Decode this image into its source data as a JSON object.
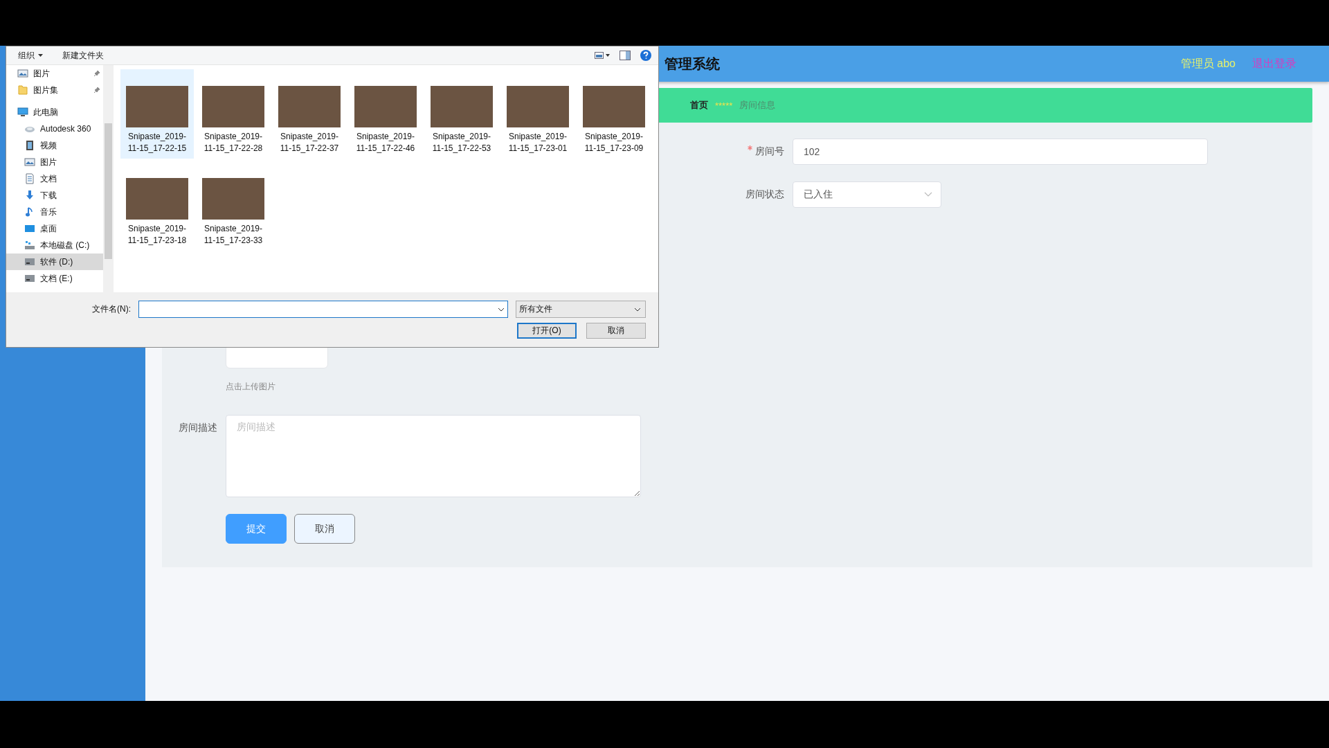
{
  "header": {
    "title": "管理系统",
    "user": "管理员 abo",
    "logout": "退出登录"
  },
  "breadcrumb": [
    {
      "kind": "home",
      "label": "首页"
    },
    {
      "kind": "separator",
      "label": "*****"
    },
    {
      "kind": "current",
      "label": "房间信息"
    }
  ],
  "form": {
    "fields": [
      {
        "kind": "input",
        "label": "房间号",
        "required": true,
        "value": "102"
      },
      {
        "kind": "select",
        "label": "房间状态",
        "required": false,
        "value": "已入住"
      }
    ],
    "upload": {
      "hint": "点击上传图片"
    },
    "description": {
      "label": "房间描述",
      "placeholder": "房间描述"
    },
    "buttons": [
      {
        "kind": "primary",
        "label": "提交"
      },
      {
        "kind": "plain",
        "label": "取消"
      }
    ]
  },
  "file_dialog": {
    "toolbar": [
      {
        "kind": "menu",
        "label": "组织"
      },
      {
        "kind": "plain",
        "label": "新建文件夹"
      }
    ],
    "nav": [
      {
        "label": "图片",
        "pinned": true,
        "selected": false
      },
      {
        "label": "图片集",
        "pinned": true,
        "selected": false
      },
      {
        "label": "此电脑",
        "pinned": false,
        "selected": false,
        "children": [
          {
            "label": "Autodesk 360",
            "pinned": false,
            "selected": false
          },
          {
            "label": "视频",
            "pinned": false,
            "selected": false
          },
          {
            "label": "图片",
            "pinned": false,
            "selected": false
          },
          {
            "label": "文档",
            "pinned": false,
            "selected": false
          },
          {
            "label": "下载",
            "pinned": false,
            "selected": false
          },
          {
            "label": "音乐",
            "pinned": false,
            "selected": false
          },
          {
            "label": "桌面",
            "pinned": false,
            "selected": false
          },
          {
            "label": "本地磁盘 (C:)",
            "pinned": false,
            "selected": false
          },
          {
            "label": "软件 (D:)",
            "pinned": false,
            "selected": true
          },
          {
            "label": "文档 (E:)",
            "pinned": false,
            "selected": false
          }
        ]
      }
    ],
    "files": [
      {
        "name": "Snipaste_2019-11-15_17-22-15",
        "selected": true
      },
      {
        "name": "Snipaste_2019-11-15_17-22-28",
        "selected": false
      },
      {
        "name": "Snipaste_2019-11-15_17-22-37",
        "selected": false
      },
      {
        "name": "Snipaste_2019-11-15_17-22-46",
        "selected": false
      },
      {
        "name": "Snipaste_2019-11-15_17-22-53",
        "selected": false
      },
      {
        "name": "Snipaste_2019-11-15_17-23-01",
        "selected": false
      },
      {
        "name": "Snipaste_2019-11-15_17-23-09",
        "selected": false
      },
      {
        "name": "Snipaste_2019-11-15_17-23-18",
        "selected": false
      },
      {
        "name": "Snipaste_2019-11-15_17-23-33",
        "selected": false
      }
    ],
    "filename_label": "文件名(N):",
    "filetype": "所有文件",
    "buttons": [
      {
        "kind": "default",
        "label": "打开(O)"
      },
      {
        "kind": "plain",
        "label": "取消"
      }
    ]
  }
}
